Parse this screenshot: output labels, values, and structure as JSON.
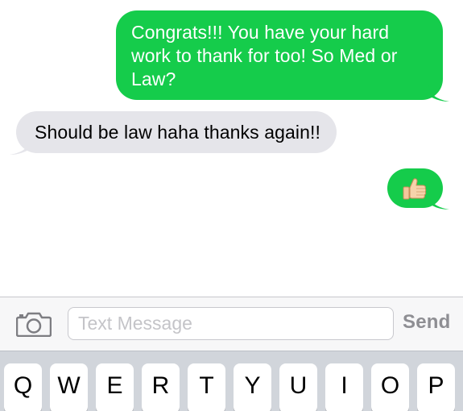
{
  "messages": [
    {
      "direction": "outgoing",
      "text": "Congrats!!! You have your hard work to thank for too! So Med or Law?"
    },
    {
      "direction": "incoming",
      "text": "Should be law haha thanks again!!"
    },
    {
      "direction": "outgoing",
      "emoji": "thumbs-up"
    }
  ],
  "input_bar": {
    "placeholder": "Text Message",
    "value": "",
    "send_label": "Send",
    "camera_icon": "camera-icon"
  },
  "keyboard": {
    "row1": [
      "Q",
      "W",
      "E",
      "R",
      "T",
      "Y",
      "U",
      "I",
      "O",
      "P"
    ]
  },
  "colors": {
    "outgoing_bubble": "#15cc4b",
    "incoming_bubble": "#e5e5ea",
    "send_disabled": "#8e8e93",
    "keyboard_bg": "#d1d5db"
  }
}
